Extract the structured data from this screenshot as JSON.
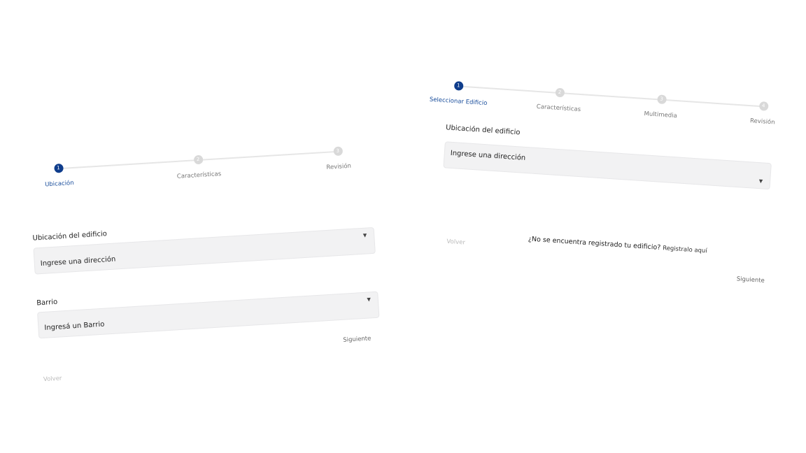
{
  "left_form": {
    "steps": [
      {
        "number": "1",
        "label": "Ubicación",
        "active": true
      },
      {
        "number": "2",
        "label": "Características",
        "active": false
      },
      {
        "number": "3",
        "label": "Revisión",
        "active": false
      }
    ],
    "location_label": "Ubicación del edificio",
    "location_placeholder": "Ingrese una dirección",
    "neighborhood_label": "Barrio",
    "neighborhood_placeholder": "Ingresá un Barrio",
    "next_label": "Siguiente",
    "back_label": "Volver"
  },
  "right_form": {
    "steps": [
      {
        "number": "1",
        "label": "Seleccionar Edificio",
        "active": true
      },
      {
        "number": "2",
        "label": "Características",
        "active": false
      },
      {
        "number": "3",
        "label": "Multimedia",
        "active": false
      },
      {
        "number": "4",
        "label": "Revisión",
        "active": false
      }
    ],
    "location_label": "Ubicación del edificio",
    "location_placeholder": "Ingrese una dirección",
    "not_registered_text": "¿No se encuentra registrado tu edificio?",
    "register_link": "Registralo aquí",
    "back_label": "Volver",
    "next_label": "Siguiente"
  },
  "colors": {
    "accent": "#0f3d8c",
    "inactive": "#d9d9d9",
    "field_bg": "#f2f2f3"
  }
}
